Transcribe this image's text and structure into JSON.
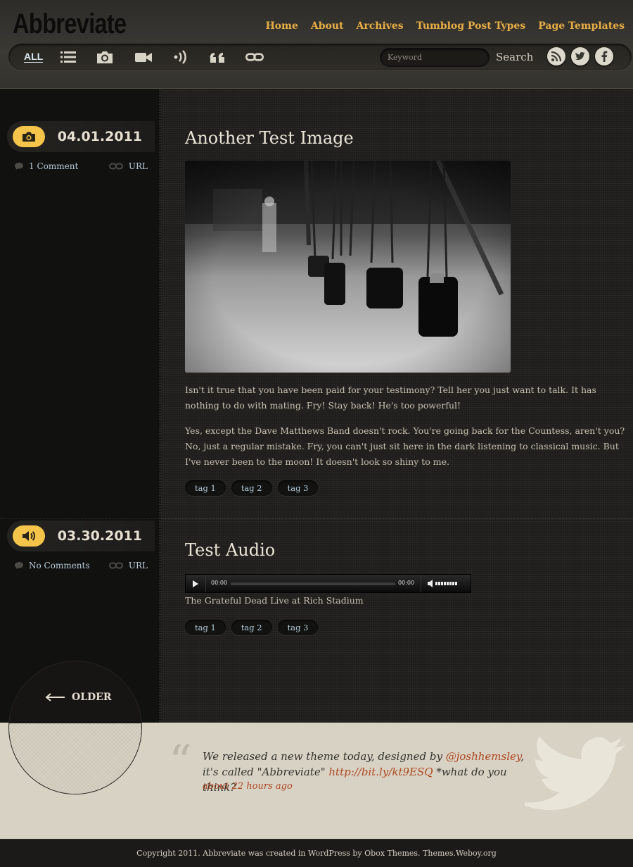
{
  "brand": {
    "logo": "Abbreviate"
  },
  "nav": {
    "items": [
      {
        "label": "Home"
      },
      {
        "label": "About"
      },
      {
        "label": "Archives"
      },
      {
        "label": "Tumblog Post Types"
      },
      {
        "label": "Page Templates"
      }
    ]
  },
  "toolbar": {
    "all_label": "ALL",
    "filters": [
      "list-icon",
      "camera-icon",
      "video-icon",
      "audio-icon",
      "quote-icon",
      "link-icon"
    ],
    "search_placeholder": "Keyword",
    "search_label": "Search",
    "social": [
      "rss-icon",
      "twitter-icon",
      "facebook-icon"
    ]
  },
  "posts": [
    {
      "type_icon": "camera-icon",
      "date": "04.01.2011",
      "comments": "1 Comment",
      "url_label": "URL",
      "title": "Another Test Image",
      "paragraphs": [
        "Isn't it true that you have been paid for your testimony? Tell her you just want to talk. It has nothing to do with mating. Fry! Stay back! He's too powerful!",
        "Yes, except the Dave Matthews Band doesn't rock. You're going back for the Countess, aren't you? No, just a regular mistake. Fry, you can't just sit here in the dark listening to classical music. But I've never been to the moon! It doesn't look so shiny to me."
      ],
      "tags": [
        "tag 1",
        "tag 2",
        "tag 3"
      ]
    },
    {
      "type_icon": "audio-icon",
      "date": "03.30.2011",
      "comments": "No Comments",
      "url_label": "URL",
      "title": "Test Audio",
      "player": {
        "current_time": "00:00",
        "duration": "00:00"
      },
      "caption": "The Grateful Dead Live at Rich Stadium",
      "tags": [
        "tag 1",
        "tag 2",
        "tag 3"
      ]
    }
  ],
  "pagination": {
    "older_label": "OLDER"
  },
  "twitter": {
    "text_before": "We released a new theme today, designed by ",
    "mention": "@joshhemsley",
    "text_middle": ", it's called \"Abbreviate\" ",
    "link": "http://bit.ly/kt9ESQ",
    "text_after": " *what do you think?",
    "time": "about 22 hours ago"
  },
  "footer": {
    "text": "Copyright 2011. Abbreviate was created in WordPress by Obox Themes. Themes.Weboy.org"
  },
  "colors": {
    "accent": "#e8ae45",
    "badge": "#f5c44a",
    "link_blue": "#b6cad6",
    "tweet_link": "#b0461f"
  }
}
